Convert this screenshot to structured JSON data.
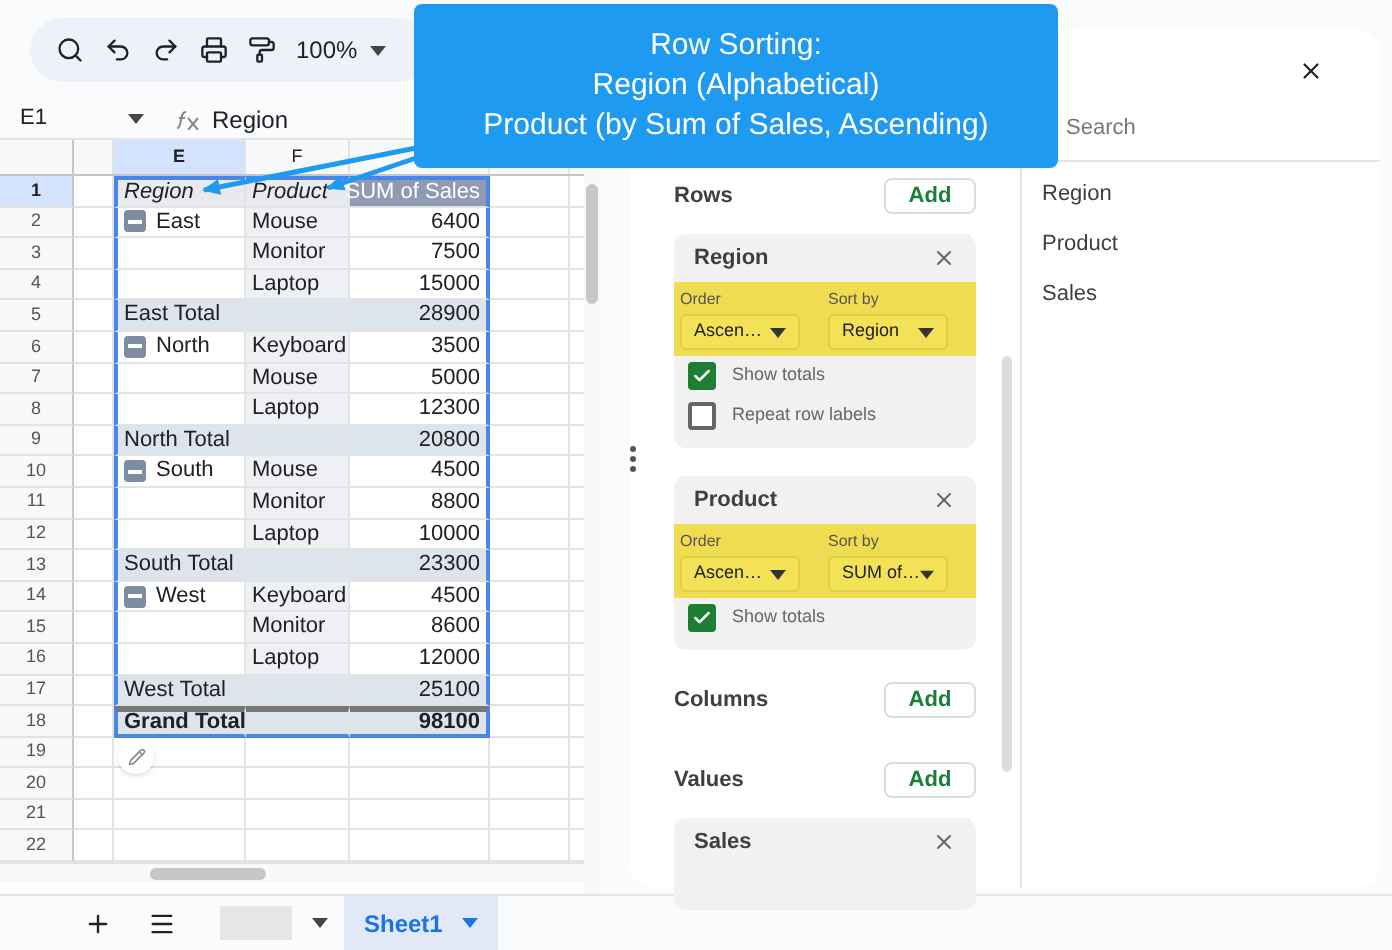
{
  "callout": {
    "lines": [
      "Row Sorting:",
      "Region (Alphabetical)",
      "Product (by Sum of Sales, Ascending)"
    ]
  },
  "toolbar": {
    "zoom": "100%"
  },
  "formula_bar": {
    "cell_ref": "E1",
    "formula": "Region"
  },
  "column_headers": [
    {
      "selected": false
    },
    {
      "letter": "E",
      "selected": true
    },
    {
      "letter": "F",
      "selected": false
    },
    {
      "selected": false
    },
    {
      "selected": false
    }
  ],
  "row_numbers": [
    {
      "label": "1",
      "selected": true
    },
    {
      "label": "2",
      "selected": false
    },
    {
      "label": "3",
      "selected": false
    },
    {
      "label": "4",
      "selected": false
    },
    {
      "label": "5",
      "selected": false
    },
    {
      "label": "6",
      "selected": false
    },
    {
      "label": "7",
      "selected": false
    },
    {
      "label": "8",
      "selected": false
    },
    {
      "label": "9",
      "selected": false
    },
    {
      "label": "10",
      "selected": false
    },
    {
      "label": "11",
      "selected": false
    },
    {
      "label": "12",
      "selected": false
    },
    {
      "label": "13",
      "selected": false
    },
    {
      "label": "14",
      "selected": false
    },
    {
      "label": "15",
      "selected": false
    },
    {
      "label": "16",
      "selected": false
    },
    {
      "label": "17",
      "selected": false
    },
    {
      "label": "18",
      "selected": false
    },
    {
      "label": "19",
      "selected": false
    },
    {
      "label": "20",
      "selected": false
    },
    {
      "label": "21",
      "selected": false
    },
    {
      "label": "22",
      "selected": false
    }
  ],
  "pivot_rows": [
    {
      "kind": "header",
      "region": "Region",
      "product": "Product",
      "sales": "SUM of Sales"
    },
    {
      "kind": "item",
      "region": "East",
      "expanded": true,
      "product": "Mouse",
      "sales": "6400"
    },
    {
      "kind": "item",
      "product": "Monitor",
      "sales": "7500"
    },
    {
      "kind": "item",
      "product": "Laptop",
      "sales": "15000"
    },
    {
      "kind": "subtotal",
      "region": "East Total",
      "sales": "28900"
    },
    {
      "kind": "item",
      "region": "North",
      "expanded": true,
      "product": "Keyboard",
      "sales": "3500"
    },
    {
      "kind": "item",
      "product": "Mouse",
      "sales": "5000"
    },
    {
      "kind": "item",
      "product": "Laptop",
      "sales": "12300"
    },
    {
      "kind": "subtotal",
      "region": "North Total",
      "sales": "20800"
    },
    {
      "kind": "item",
      "region": "South",
      "expanded": true,
      "product": "Mouse",
      "sales": "4500"
    },
    {
      "kind": "item",
      "product": "Monitor",
      "sales": "8800"
    },
    {
      "kind": "item",
      "product": "Laptop",
      "sales": "10000"
    },
    {
      "kind": "subtotal",
      "region": "South Total",
      "sales": "23300"
    },
    {
      "kind": "item",
      "region": "West",
      "expanded": true,
      "product": "Keyboard",
      "sales": "4500"
    },
    {
      "kind": "item",
      "product": "Monitor",
      "sales": "8600"
    },
    {
      "kind": "item",
      "product": "Laptop",
      "sales": "12000"
    },
    {
      "kind": "subtotal",
      "region": "West Total",
      "sales": "25100"
    },
    {
      "kind": "grand",
      "region": "Grand Total",
      "sales": "98100"
    }
  ],
  "editor": {
    "sections": [
      {
        "label": "Rows",
        "add": "Add",
        "fields": [
          {
            "name": "Region",
            "highlighted": true,
            "order_label": "Order",
            "order": "Ascen…",
            "sort_label": "Sort by",
            "sort_by": "Region",
            "options": [
              {
                "label": "Show totals",
                "checked": true
              },
              {
                "label": "Repeat row labels",
                "checked": false
              }
            ]
          },
          {
            "name": "Product",
            "highlighted": true,
            "order_label": "Order",
            "order": "Ascen…",
            "sort_label": "Sort by",
            "sort_by": "SUM of…",
            "options": [
              {
                "label": "Show totals",
                "checked": true
              }
            ]
          }
        ]
      },
      {
        "label": "Columns",
        "add": "Add"
      },
      {
        "label": "Values",
        "add": "Add",
        "fields": [
          {
            "name": "Sales"
          }
        ]
      }
    ]
  },
  "field_list": {
    "search": {
      "placeholder": "Search"
    },
    "items": [
      "Region",
      "Product",
      "Sales"
    ]
  },
  "bottom_bar": {
    "tabs": [
      {
        "selected": false
      },
      {
        "label": "Sheet1",
        "selected": true
      }
    ]
  }
}
